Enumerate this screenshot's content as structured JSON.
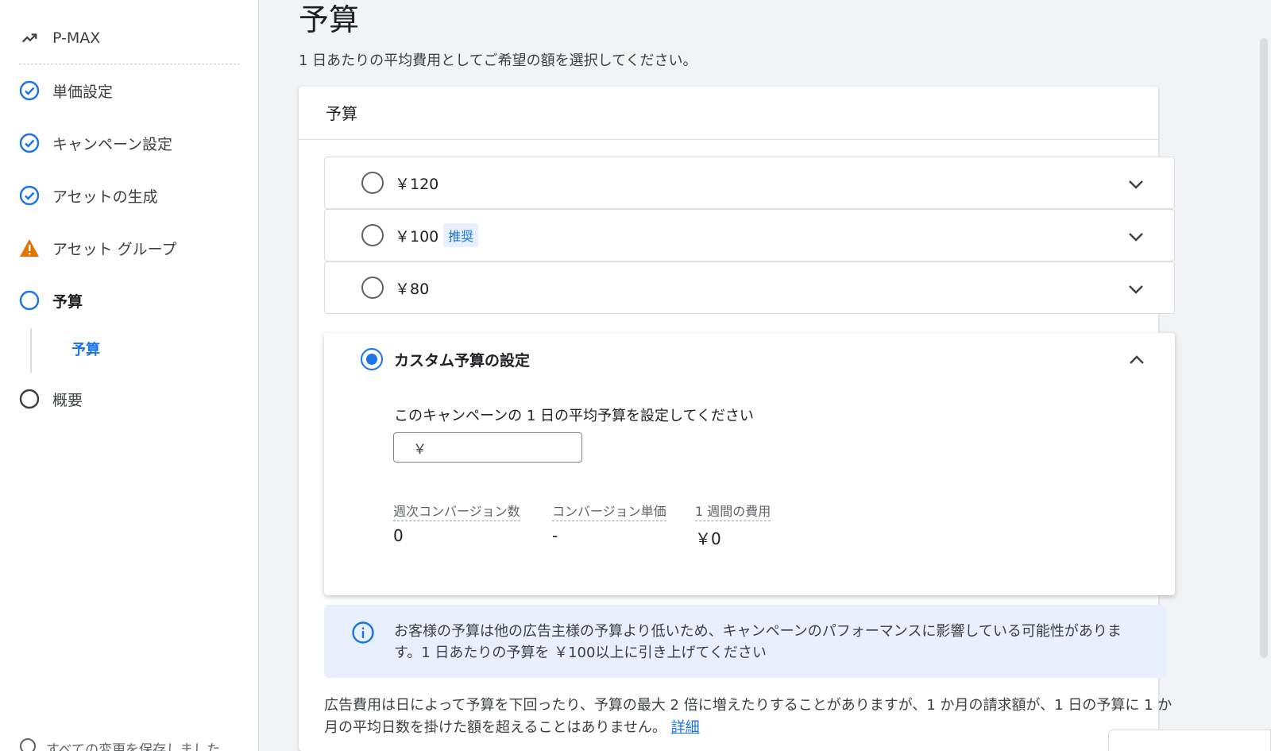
{
  "sidebar": {
    "items": [
      {
        "label": "P-MAX",
        "icon": "trending-up-icon"
      },
      {
        "label": "単価設定",
        "icon": "check-circle-icon"
      },
      {
        "label": "キャンペーン設定",
        "icon": "check-circle-icon"
      },
      {
        "label": "アセットの生成",
        "icon": "check-circle-icon"
      },
      {
        "label": "アセット グループ",
        "icon": "warning-icon"
      },
      {
        "label": "予算",
        "icon": "circle-outline-icon"
      },
      {
        "label": "概要",
        "icon": "circle-outline-icon"
      }
    ],
    "sub_item": "予算",
    "saved_status": "すべての変更を保存しました"
  },
  "page": {
    "title": "予算",
    "subtitle": "1 日あたりの平均費用としてご希望の額を選択してください。"
  },
  "card": {
    "header": "予算",
    "options": [
      {
        "label": "￥120",
        "badge": ""
      },
      {
        "label": "￥100",
        "badge": "推奨"
      },
      {
        "label": "￥80",
        "badge": ""
      }
    ],
    "custom": {
      "label": "カスタム予算の設定",
      "prompt": "このキャンペーンの 1 日の平均予算を設定してください",
      "currency": "￥",
      "input_value": "",
      "stats": [
        {
          "label": "週次コンバージョン数",
          "value": "0"
        },
        {
          "label": "コンバージョン単価",
          "value": "-"
        },
        {
          "label": "1 週間の費用",
          "value": "￥0"
        }
      ]
    },
    "info_text": "お客様の予算は他の広告主様の予算より低いため、キャンペーンのパフォーマンスに影響している可能性があります。1 日あたりの予算を ￥100以上に引き上げてください",
    "footnote": "広告費用は日によって予算を下回ったり、予算の最大 2 倍に増えたりすることがありますが、1 か月の請求額が、1 日の予算に 1 か月の平均日数を掛けた額を超えることはありません。",
    "footnote_link": "詳細"
  },
  "colors": {
    "accent": "#1a73e8",
    "warning": "#e37400",
    "info_bg": "#e8f0fe"
  }
}
